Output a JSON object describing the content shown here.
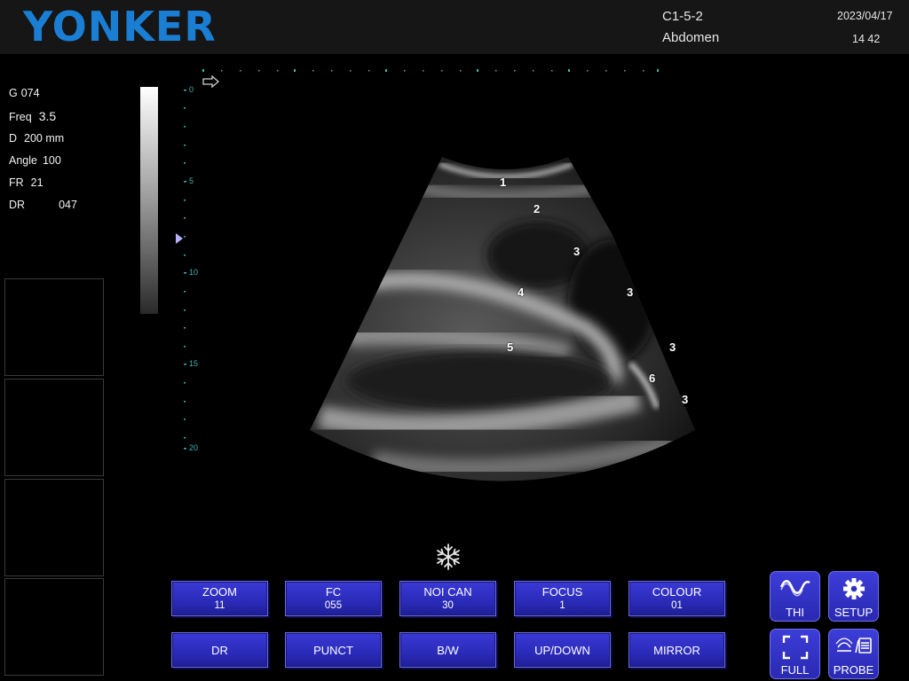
{
  "header": {
    "logo_text": "YONKER",
    "probe_code": "C1-5-2",
    "preset": "Abdomen",
    "date": "2023/04/17",
    "time": "14 42"
  },
  "params": [
    {
      "key": "G",
      "value": "074"
    },
    {
      "key": "Freq",
      "value": "3.5"
    },
    {
      "key": "D",
      "value": "200 mm"
    },
    {
      "key": "Angle",
      "value": "100"
    },
    {
      "key": "FR",
      "value": "21"
    },
    {
      "key": "DR",
      "value": "047"
    }
  ],
  "depth_scale": [
    "0",
    "5",
    "10",
    "15",
    "20"
  ],
  "image_labels": [
    "1",
    "2",
    "3",
    "4",
    "3",
    "3",
    "5",
    "6",
    "3"
  ],
  "panel_buttons": [
    {
      "label": "ZOOM",
      "value": "11"
    },
    {
      "label": "FC",
      "value": "055"
    },
    {
      "label": "NOI CAN",
      "value": "30"
    },
    {
      "label": "FOCUS",
      "value": "1"
    },
    {
      "label": "COLOUR",
      "value": "01"
    },
    {
      "label": "DR"
    },
    {
      "label": "PUNCT"
    },
    {
      "label": "B/W"
    },
    {
      "label": "UP/DOWN"
    },
    {
      "label": "MIRROR"
    }
  ],
  "side_buttons": [
    {
      "label": "THI",
      "icon": "thi-wave-icon"
    },
    {
      "label": "SETUP",
      "icon": "gear-icon"
    },
    {
      "label": "FULL",
      "icon": "fullscreen-icon"
    },
    {
      "label": "PROBE",
      "icon": "probe-icon"
    }
  ],
  "freeze_icon": "snowflake-icon",
  "colors": {
    "brand": "#1a7fd4",
    "button": "#2a2ab8",
    "scale_text": "#3fb6b0"
  }
}
